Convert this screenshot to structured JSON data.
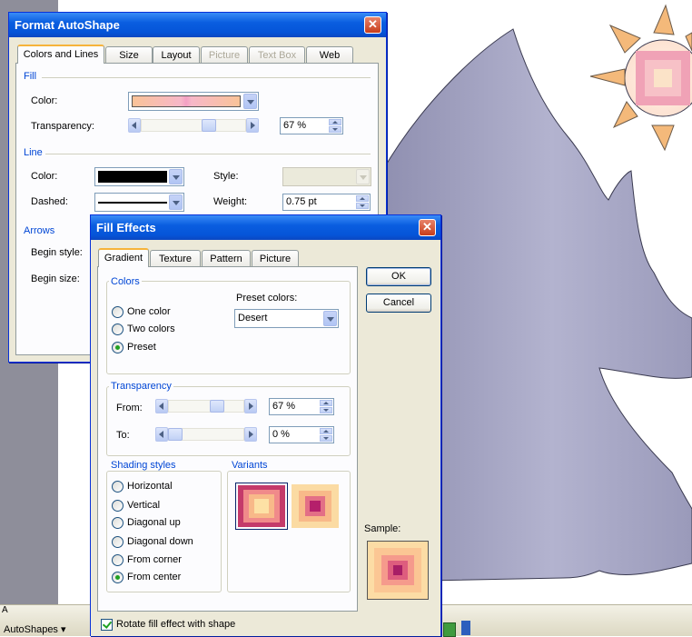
{
  "background": {
    "statusbar_letter": "A",
    "autoshapes_label": "AutoShapes ▾"
  },
  "format_autoshape": {
    "title": "Format AutoShape",
    "tabs": [
      {
        "label": "Colors and Lines",
        "active": true,
        "disabled": false
      },
      {
        "label": "Size",
        "active": false,
        "disabled": false
      },
      {
        "label": "Layout",
        "active": false,
        "disabled": false
      },
      {
        "label": "Picture",
        "active": false,
        "disabled": true
      },
      {
        "label": "Text Box",
        "active": false,
        "disabled": true
      },
      {
        "label": "Web",
        "active": false,
        "disabled": false
      }
    ],
    "fill": {
      "section": "Fill",
      "color_label": "Color:",
      "transparency_label": "Transparency:",
      "transparency_value": "67 %",
      "transparency_level": 0.67
    },
    "line": {
      "section": "Line",
      "color_label": "Color:",
      "dashed_label": "Dashed:",
      "style_label": "Style:",
      "weight_label": "Weight:",
      "weight_value": "0.75 pt"
    },
    "arrows": {
      "section": "Arrows",
      "begin_style_label": "Begin style:",
      "begin_size_label": "Begin size:"
    }
  },
  "fill_effects": {
    "title": "Fill Effects",
    "tabs": [
      {
        "label": "Gradient",
        "active": true
      },
      {
        "label": "Texture",
        "active": false
      },
      {
        "label": "Pattern",
        "active": false
      },
      {
        "label": "Picture",
        "active": false
      }
    ],
    "ok_label": "OK",
    "cancel_label": "Cancel",
    "colors": {
      "group_title": "Colors",
      "options": [
        {
          "label": "One color",
          "selected": false
        },
        {
          "label": "Two colors",
          "selected": false
        },
        {
          "label": "Preset",
          "selected": true
        }
      ],
      "preset_label": "Preset colors:",
      "preset_value": "Desert"
    },
    "transparency": {
      "group_title": "Transparency",
      "from_label": "From:",
      "from_value": "67 %",
      "from_level": 0.67,
      "to_label": "To:",
      "to_value": "0 %",
      "to_level": 0.0
    },
    "shading": {
      "group_title": "Shading styles",
      "options": [
        {
          "label": "Horizontal",
          "selected": false
        },
        {
          "label": "Vertical",
          "selected": false
        },
        {
          "label": "Diagonal up",
          "selected": false
        },
        {
          "label": "Diagonal down",
          "selected": false
        },
        {
          "label": "From corner",
          "selected": false
        },
        {
          "label": "From center",
          "selected": true
        }
      ]
    },
    "variants_title": "Variants",
    "sample_label": "Sample:",
    "rotate_label": "Rotate fill effect with shape",
    "rotate_checked": true
  },
  "colors": {
    "title_bar": "#0a5ee0",
    "mountain": "#a4a4c2",
    "sun_ray": "#f4b97a",
    "accent_green": "#21a121"
  }
}
